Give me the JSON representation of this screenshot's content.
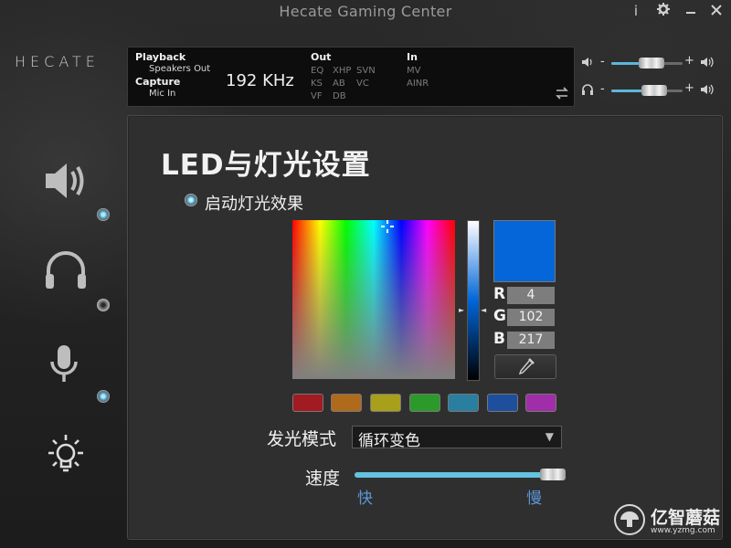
{
  "app": {
    "title": "Hecate Gaming Center",
    "logo_text": "HECATE",
    "window_buttons": [
      "info-icon",
      "gear-icon",
      "minimize-icon",
      "close-icon"
    ]
  },
  "info_panel": {
    "playback_label": "Playback",
    "playback_device": "Speakers Out",
    "capture_label": "Capture",
    "capture_device": "Mic In",
    "sample_rate": "192 KHz",
    "out_label": "Out",
    "out_items": [
      "EQ",
      "XHP",
      "SVN",
      "KS",
      "AB",
      "VC",
      "VF",
      "DB"
    ],
    "in_label": "In",
    "in_items": [
      "MV",
      "AINR"
    ]
  },
  "volume": {
    "speaker_level": 0.57,
    "headphone_level": 0.6
  },
  "sidebar": {
    "items": [
      {
        "icon": "speaker-icon",
        "active": true
      },
      {
        "icon": "headphones-icon",
        "active": false
      },
      {
        "icon": "microphone-icon",
        "active": true
      },
      {
        "icon": "light-bulb-icon",
        "active": true
      }
    ]
  },
  "led": {
    "page_title": "LED与灯光设置",
    "enable_label": "启动灯光效果",
    "selected_color": "#0466d9",
    "r_label": "R",
    "g_label": "G",
    "b_label": "B",
    "r": "4",
    "g": "102",
    "b": "217",
    "presets": [
      "#a21a22",
      "#b06a1c",
      "#a8a01a",
      "#2c9a2a",
      "#2a7ea0",
      "#1d4f9c",
      "#a02ea8"
    ],
    "mode_label": "发光模式",
    "mode_value": "循环变色",
    "speed_label": "速度",
    "speed_min": "快",
    "speed_max": "慢",
    "speed_level": 0.95
  },
  "watermark": {
    "name": "亿智蘑菇",
    "url": "www.yzmg.com"
  }
}
